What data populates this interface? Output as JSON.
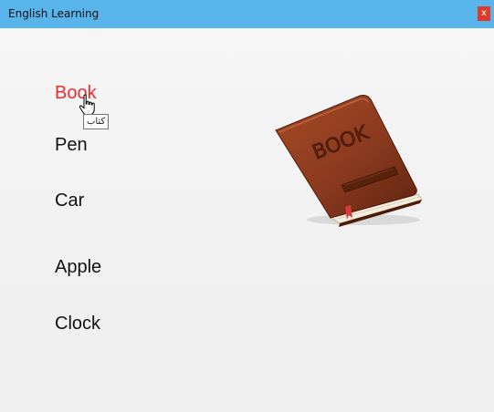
{
  "window": {
    "title": "English Learning",
    "close_label": "x"
  },
  "words": [
    {
      "label": "Book",
      "active": true
    },
    {
      "label": "Pen",
      "active": false
    },
    {
      "label": "Car",
      "active": false
    },
    {
      "label": "Apple",
      "active": false
    },
    {
      "label": "Clock",
      "active": false
    }
  ],
  "tooltip": {
    "text": "کتاب"
  },
  "image": {
    "cover_text": "BOOK",
    "icon": "book-icon"
  },
  "colors": {
    "titlebar": "#5ab4ec",
    "close": "#e03a2b",
    "active_word": "#ee2a2a",
    "word": "#111111",
    "book_cover": "#8b3a1f"
  }
}
